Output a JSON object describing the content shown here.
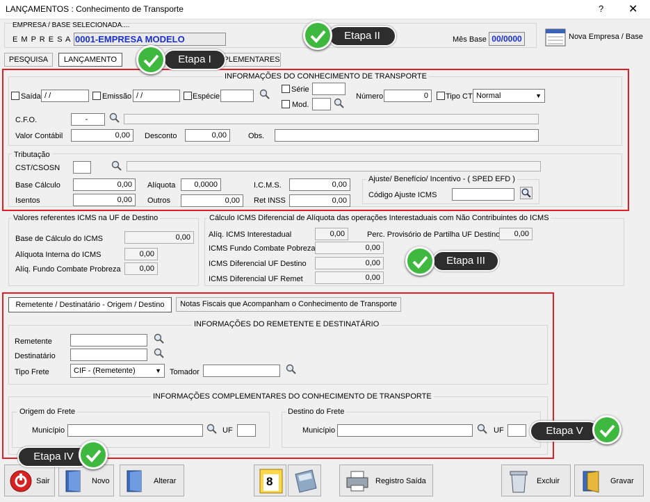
{
  "window": {
    "title": "LANÇAMENTOS : Conhecimento de Transporte",
    "help": "?",
    "close": "✕"
  },
  "header": {
    "empresa_label": "EMPRESA / BASE SELECIONADA....",
    "empresa_prefix": "E M P R E S A",
    "empresa_value": "0001-EMPRESA MODELO",
    "mes_base_label": "Mês Base",
    "mes_base_value": "00/0000",
    "nova_empresa": "Nova Empresa / Base"
  },
  "tabs": {
    "pesquisa": "PESQUISA",
    "lancamento": "LANÇAMENTO",
    "complementares": "PLEMENTARES"
  },
  "callouts": {
    "etapa1": "Etapa I",
    "etapa2": "Etapa II",
    "etapa3": "Etapa III",
    "etapa4": "Etapa IV",
    "etapa5": "Etapa V"
  },
  "conhecimento": {
    "title": "INFORMAÇÕES DO CONHECIMENTO DE TRANSPORTE",
    "saida": "Saída",
    "saida_value": " / /",
    "emissao": "Emissão",
    "emissao_value": " / /",
    "especie": "Espécie",
    "serie": "Série",
    "mod": "Mod.",
    "numero": "Número",
    "numero_value": "0",
    "tipo_ct": "Tipo CT",
    "tipo_ct_value": "Normal",
    "cfo": "C.F.O.",
    "cfo_value": "-",
    "valor_contabil": "Valor Contábil",
    "valor_contabil_value": "0,00",
    "desconto": "Desconto",
    "desconto_value": "0,00",
    "obs": "Obs."
  },
  "tributacao": {
    "title": "Tributação",
    "cst": "CST/CSOSN",
    "base_calculo": "Base Cálculo",
    "base_calculo_value": "0,00",
    "aliquota": "Alíquota",
    "aliquota_value": "0,0000",
    "icms": "I.C.M.S.",
    "icms_value": "0,00",
    "isentos": "Isentos",
    "isentos_value": "0,00",
    "outros": "Outros",
    "outros_value": "0,00",
    "ret_inss": "Ret INSS",
    "ret_inss_value": "0,00",
    "ajuste_title": "Ajuste/ Benefício/ Incentivo - ( SPED EFD )",
    "codigo_ajuste": "Código Ajuste ICMS"
  },
  "uf_destino": {
    "title": "Valores referentes ICMS na UF de Destino",
    "base": "Base de Cálculo do ICMS",
    "base_value": "0,00",
    "aliq_interna": "Alíquota Interna do ICMS",
    "aliq_interna_value": "0,00",
    "aliq_fundo": "Alíq. Fundo Combate Probreza",
    "aliq_fundo_value": "0,00"
  },
  "difal": {
    "title": "Cálculo ICMS Diferencial de Alíquota das operações Interestaduais com Não Contribuintes do ICMS",
    "aliq_inter": "Alíq. ICMS Interestadual",
    "aliq_inter_value": "0,00",
    "perc_prov": "Perc. Provisório de Partilha UF Destino",
    "perc_prov_value": "0,00",
    "fundo_pobreza": "ICMS Fundo Combate Pobreza",
    "fundo_pobreza_value": "0,00",
    "dif_destino": "ICMS Diferencial UF Destino",
    "dif_destino_value": "0,00",
    "dif_remet": "ICMS Diferencial UF Remet",
    "dif_remet_value": "0,00"
  },
  "subtabs": {
    "remetente": "Remetente / Destinatário - Origem / Destino",
    "notas": "Notas Fiscais que Acompanham o Conhecimento de Transporte"
  },
  "remetente": {
    "title": "INFORMAÇÕES DO REMETENTE E DESTINATÁRIO",
    "remetente": "Remetente",
    "destinatario": "Destinatário",
    "tipo_frete": "Tipo Frete",
    "tipo_frete_value": "CIF - (Remetente)",
    "tomador": "Tomador"
  },
  "complementares": {
    "title": "INFORMAÇÕES COMPLEMENTARES DO CONHECIMENTO DE TRANSPORTE",
    "origem": "Origem do Frete",
    "destino": "Destino do Frete",
    "municipio": "Município",
    "uf": "UF"
  },
  "buttons": {
    "sair": "Sair",
    "novo": "Novo",
    "alterar": "Alterar",
    "calendar_day": "8",
    "registro_saida": "Registro Saída",
    "excluir": "Excluir",
    "gravar": "Gravar"
  },
  "colors": {
    "red_highlight": "#e11c24",
    "check_green": "#3eb83e",
    "callout_bg": "#2d2d2d",
    "empresa_blue": "#1a2fd0"
  }
}
